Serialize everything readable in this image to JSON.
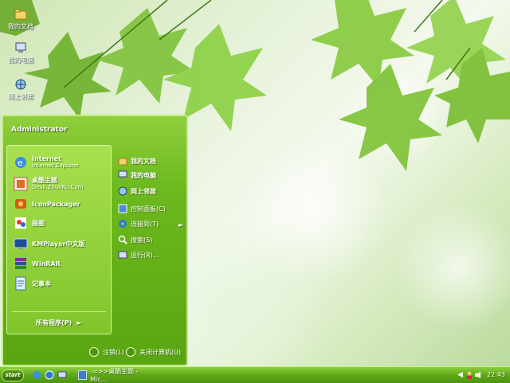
{
  "desktop": {
    "icons": [
      {
        "label": "我的文档",
        "icon": "folder-icon"
      },
      {
        "label": "我的电脑",
        "icon": "computer-icon"
      },
      {
        "label": "网上邻居",
        "icon": "network-icon"
      }
    ]
  },
  "start_menu": {
    "user": "Administrator",
    "programs": [
      {
        "title": "Internet",
        "subtitle": "Internet Explorer",
        "icon": "ie-icon"
      },
      {
        "title": "桌酷主题",
        "subtitle": "Desk.ZhuoKu.Com",
        "icon": "zhuoku-icon"
      },
      {
        "title": "IconPackager",
        "subtitle": "",
        "icon": "iconpackager-icon"
      },
      {
        "title": "画图",
        "subtitle": "",
        "icon": "paint-icon"
      },
      {
        "title": "KMPlayer中文版",
        "subtitle": "",
        "icon": "kmplayer-icon"
      },
      {
        "title": "WinRAR",
        "subtitle": "",
        "icon": "winrar-icon"
      },
      {
        "title": "记事本",
        "subtitle": "",
        "icon": "notepad-icon"
      }
    ],
    "all_programs": "所有程序(P)",
    "places": [
      {
        "label": "我的文档",
        "bold": true,
        "icon": "folder-icon"
      },
      {
        "label": "我的电脑",
        "bold": true,
        "icon": "computer-icon"
      },
      {
        "label": "网上邻居",
        "bold": true,
        "icon": "network-icon"
      },
      {
        "label": "控制面板(C)",
        "bold": false,
        "icon": "control-panel-icon"
      },
      {
        "label": "连接到(T)",
        "bold": false,
        "icon": "connect-icon"
      },
      {
        "label": "搜索(S)",
        "bold": false,
        "icon": "search-icon"
      },
      {
        "label": "运行(R)...",
        "bold": false,
        "icon": "run-icon"
      }
    ],
    "logoff": "注销(L)",
    "shutdown": "关闭计算机(U)"
  },
  "taskbar": {
    "start": "start",
    "quick_launch": [
      "ie-icon",
      "globe-icon",
      "desktop-icon"
    ],
    "task_button": "-=>>桌酷主题 - Mic...",
    "clock": "22:43"
  },
  "colors": {
    "menu_green": "#6cb81e",
    "menu_light": "#a9e04f",
    "taskbar_green": "#5fa817"
  }
}
